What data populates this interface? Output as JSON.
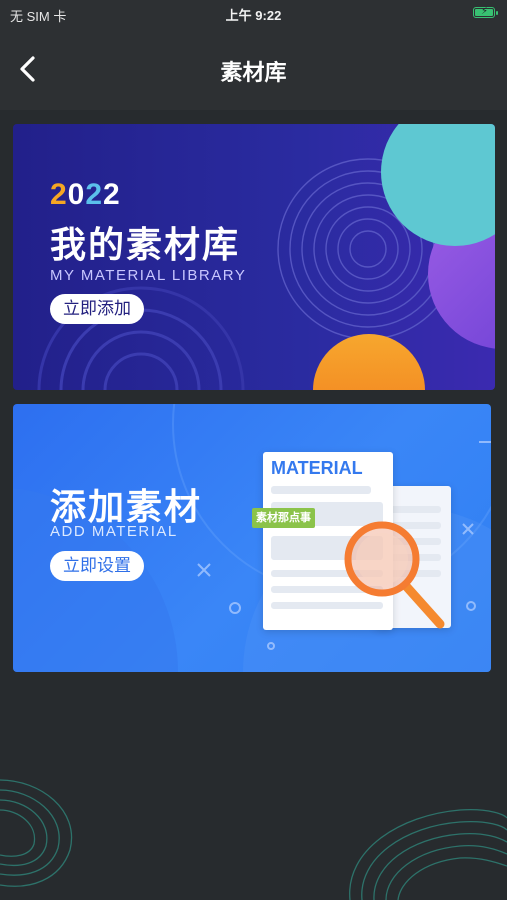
{
  "status": {
    "carrier": "无 SIM 卡",
    "time": "上午 9:22"
  },
  "nav": {
    "title": "素材库"
  },
  "card1": {
    "year": "2022",
    "title": "我的素材库",
    "subtitle": "MY MATERIAL LIBRARY",
    "button": "立即添加"
  },
  "card2": {
    "title": "添加素材",
    "subtitle": "ADD MATERIAL",
    "button": "立即设置",
    "doc_label": "MATERIAL",
    "tag": "素材那点事"
  },
  "colors": {
    "background": "#272b2e",
    "card1_bg": "#24228e",
    "card2_bg": "#3580f3",
    "accent_orange": "#f5a623",
    "battery": "#38c172"
  }
}
